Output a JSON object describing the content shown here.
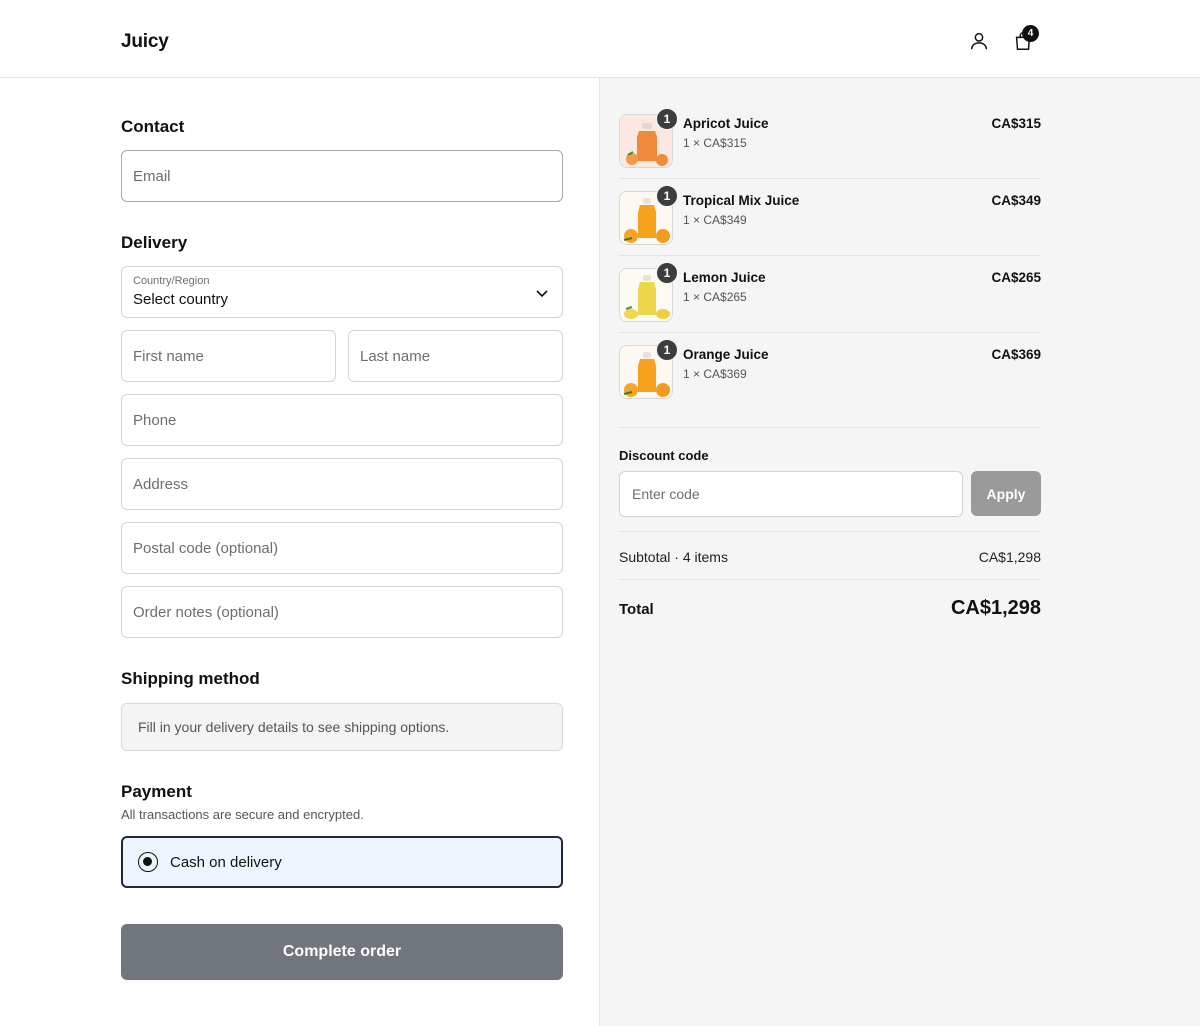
{
  "header": {
    "brand": "Juicy",
    "cart_count": "4"
  },
  "contact": {
    "title": "Contact",
    "email_placeholder": "Email"
  },
  "delivery": {
    "title": "Delivery",
    "country_label": "Country/Region",
    "country_value": "Select country",
    "first_name_placeholder": "First name",
    "last_name_placeholder": "Last name",
    "phone_placeholder": "Phone",
    "address_placeholder": "Address",
    "postal_placeholder": "Postal code (optional)",
    "notes_placeholder": "Order notes (optional)"
  },
  "shipping": {
    "title": "Shipping method",
    "notice": "Fill in your delivery details to see shipping options."
  },
  "payment": {
    "title": "Payment",
    "subtitle": "All transactions are secure and encrypted.",
    "option": "Cash on delivery"
  },
  "complete_button": "Complete order",
  "items": [
    {
      "name": "Apricot Juice",
      "qty": "1",
      "unit": "1 × CA$315",
      "price": "CA$315",
      "icon": "apricot-juice-icon",
      "color": "#f08a3a"
    },
    {
      "name": "Tropical Mix Juice",
      "qty": "1",
      "unit": "1 × CA$349",
      "price": "CA$349",
      "icon": "tropical-juice-icon",
      "color": "#f6a21c"
    },
    {
      "name": "Lemon Juice",
      "qty": "1",
      "unit": "1 × CA$265",
      "price": "CA$265",
      "icon": "lemon-juice-icon",
      "color": "#eed64a"
    },
    {
      "name": "Orange Juice",
      "qty": "1",
      "unit": "1 × CA$369",
      "price": "CA$369",
      "icon": "orange-juice-icon",
      "color": "#f6a21c"
    }
  ],
  "discount": {
    "label": "Discount code",
    "placeholder": "Enter code",
    "apply": "Apply"
  },
  "totals": {
    "subtotal_label": "Subtotal · 4 items",
    "subtotal_value": "CA$1,298",
    "total_label": "Total",
    "total_value": "CA$1,298"
  }
}
